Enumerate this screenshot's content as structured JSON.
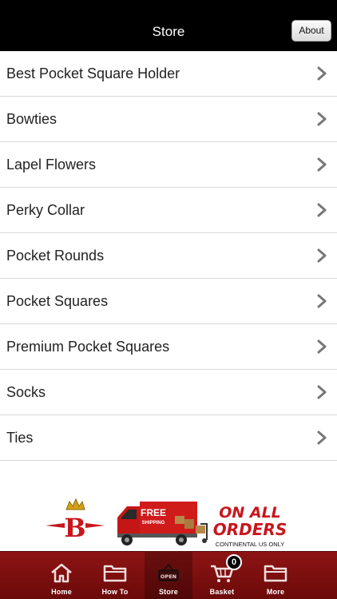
{
  "navbar": {
    "title": "Store",
    "about_label": "About"
  },
  "categories": [
    {
      "label": "Best Pocket Square Holder"
    },
    {
      "label": "Bowties"
    },
    {
      "label": "Lapel Flowers"
    },
    {
      "label": "Perky Collar"
    },
    {
      "label": "Pocket Rounds"
    },
    {
      "label": "Pocket Squares"
    },
    {
      "label": "Premium Pocket Squares"
    },
    {
      "label": "Socks"
    },
    {
      "label": "Ties"
    }
  ],
  "banner": {
    "logo_letter": "B",
    "truck_free": "FREE",
    "truck_shipping": "SHIPPING",
    "headline_1": "ON ALL",
    "headline_2": "ORDERS",
    "subline": "CONTINENTAL US ONLY"
  },
  "tabbar": {
    "tabs": [
      {
        "label": "Home",
        "icon": "home-icon"
      },
      {
        "label": "How To",
        "icon": "folder-icon"
      },
      {
        "label": "Store",
        "icon": "open-sign-icon",
        "sign_text": "OPEN"
      },
      {
        "label": "Basket",
        "icon": "cart-icon",
        "badge": "0"
      },
      {
        "label": "More",
        "icon": "folder-icon"
      }
    ]
  },
  "colors": {
    "navbar": "#000000",
    "tabbar": "#8e1414",
    "banner_red": "#c8161d"
  }
}
